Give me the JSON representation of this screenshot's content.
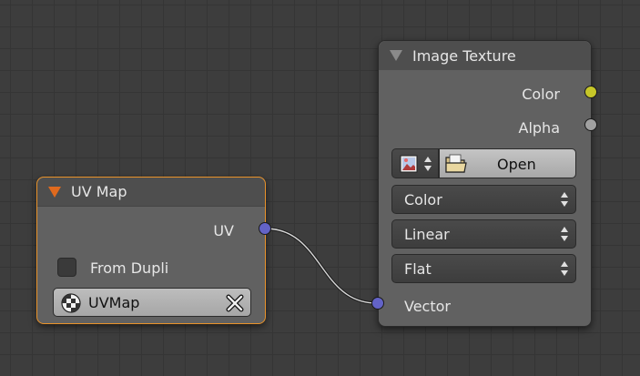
{
  "uv_map_node": {
    "title": "UV Map",
    "output_uv": "UV",
    "from_dupli_label": "From Dupli",
    "from_dupli_checked": false,
    "uvmap_value": "UVMap",
    "uvmap_icon": "uv-checker-icon",
    "clear_icon": "close-icon",
    "border_color": "#e8922a"
  },
  "image_texture_node": {
    "title": "Image Texture",
    "output_color": "Color",
    "output_alpha": "Alpha",
    "open_label": "Open",
    "image_icon": "image-icon",
    "folder_icon": "folder-icon",
    "dropdowns": [
      "Color",
      "Linear",
      "Flat"
    ],
    "input_vector": "Vector"
  },
  "socket_colors": {
    "color": "#c7c729",
    "alpha": "#a1a1a1",
    "vector": "#6363c7"
  }
}
